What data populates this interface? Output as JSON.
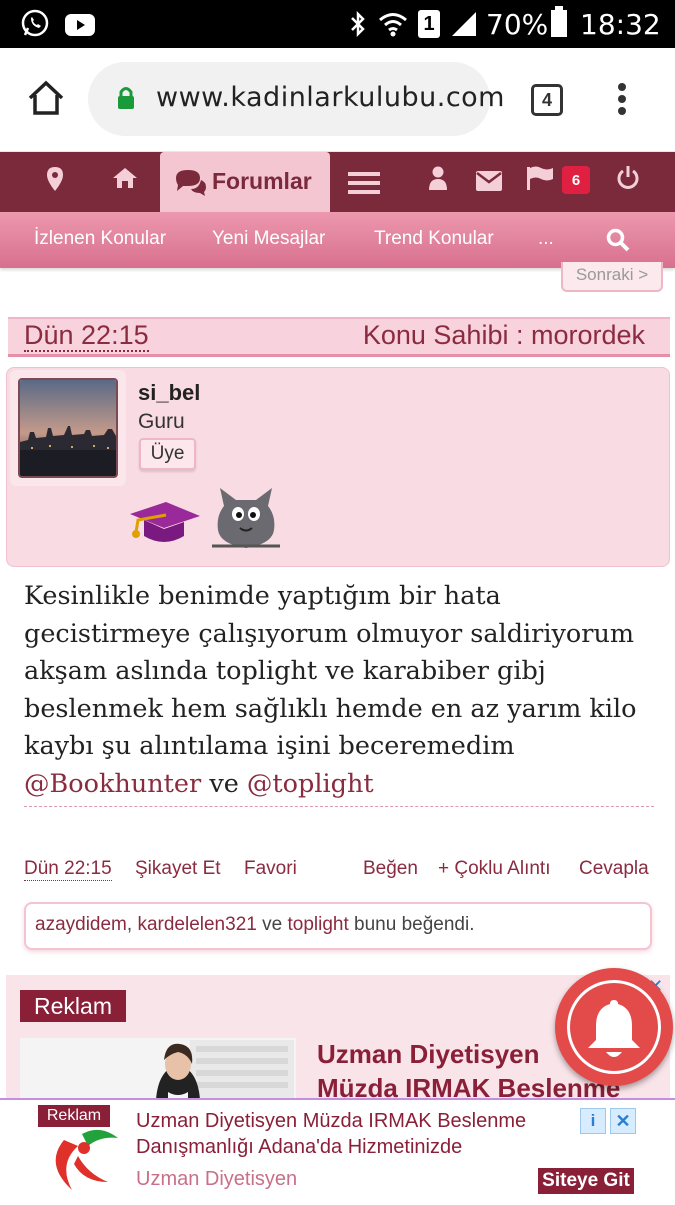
{
  "status_bar": {
    "battery": "70%",
    "time": "18:32",
    "sim": "1"
  },
  "browser": {
    "url": "www.kadinlarkulubu.com",
    "tab_count": "4"
  },
  "forum_nav": {
    "active_tab": "Forumlar",
    "notification_count": "6",
    "sub_items": [
      "İzlenen Konular",
      "Yeni Mesajlar",
      "Trend Konular",
      "..."
    ]
  },
  "pagination": {
    "next_label": "Sonraki >"
  },
  "post": {
    "date": "Dün 22:15",
    "owner_label": "Konu Sahibi : morordek",
    "author": {
      "username": "si_bel",
      "title": "Guru",
      "role": "Üye"
    },
    "message": {
      "text": "Kesinlikle benimde yaptığım bir hata gecistirmeye çalışıyorum olmuyor saldiriyorum akşam aslında toplight ve karabiber gibj beslenmek hem sağlıklı hemde en az yarım kilo kaybı şu alıntılama işini beceremedim",
      "mention1": "@Bookhunter",
      "connector": "ve",
      "mention2": "@toplight"
    },
    "actions": {
      "date": "Dün 22:15",
      "report": "Şikayet Et",
      "favorite": "Favori",
      "like": "Beğen",
      "multi_quote": "+ Çoklu Alıntı",
      "reply": "Cevapla"
    },
    "likes": {
      "user1": "azaydidem",
      "separator": ",",
      "user2": "kardelelen321",
      "connector": "ve",
      "user3": "toplight",
      "suffix": "bunu beğendi."
    }
  },
  "ad": {
    "label": "Reklam",
    "headline_line1": "Uzman Diyetisyen",
    "headline_line2": "Müzda IRMAK Beslenme"
  },
  "banner": {
    "label": "Reklam",
    "title": "Uzman Diyetisyen Müzda IRMAK Beslenme Danışmanlığı Adana'da Hizmetinizde",
    "subtitle": "Uzman Diyetisyen",
    "info": "i",
    "close": "✕",
    "cta": "Siteye Git"
  },
  "colors": {
    "nav_dark": "#7a2a3a",
    "nav_pink": "#d8708e",
    "accent": "#8a2b3f",
    "card_bg": "#f9dbe3",
    "bell": "#e34a4a"
  }
}
